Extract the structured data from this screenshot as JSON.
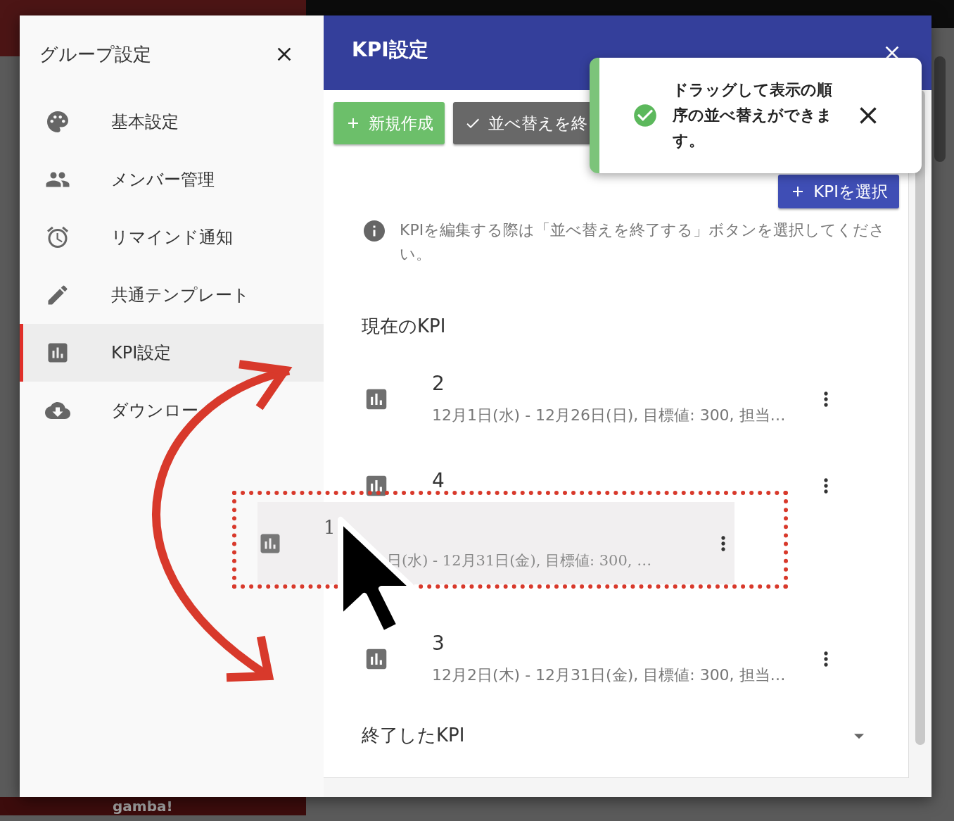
{
  "background": {
    "logo": "gamba!"
  },
  "sidebar": {
    "title": "グループ設定",
    "items": [
      {
        "kind": "palette",
        "label": "基本設定",
        "selected": false
      },
      {
        "kind": "people",
        "label": "メンバー管理",
        "selected": false
      },
      {
        "kind": "alarm",
        "label": "リマインド通知",
        "selected": false
      },
      {
        "kind": "edit",
        "label": "共通テンプレート",
        "selected": false
      },
      {
        "kind": "chart",
        "label": "KPI設定",
        "selected": true
      },
      {
        "kind": "download",
        "label": "ダウンロー",
        "selected": false
      }
    ]
  },
  "panel": {
    "title": "KPI設定",
    "buttons": [
      {
        "kind": "create",
        "label": "新規作成"
      },
      {
        "kind": "finish",
        "label": "並べ替えを終"
      }
    ],
    "select_button": "KPIを選択",
    "info": "KPIを編集する際は「並べ替えを終了する」ボタンを選択してください。",
    "current_heading": "現在のKPI",
    "kpis": [
      {
        "kind": "item",
        "title": "2",
        "detail": "12月1日(水) - 12月26日(日), 目標値: 300, 担当…"
      },
      {
        "kind": "item",
        "title": "4"
      },
      {
        "kind": "slot"
      },
      {
        "kind": "item",
        "title": "3",
        "detail": "12月2日(木) - 12月31日(金), 目標値: 300, 担当…"
      }
    ],
    "dragged": {
      "title": "1",
      "detail": "日(水) - 12月31日(金), 目標値: 300, …"
    },
    "ended_heading": "終了したKPI",
    "ended_expanded": false
  },
  "toast": {
    "message": "ドラッグして表示の順序の並べ替えができます。"
  }
}
